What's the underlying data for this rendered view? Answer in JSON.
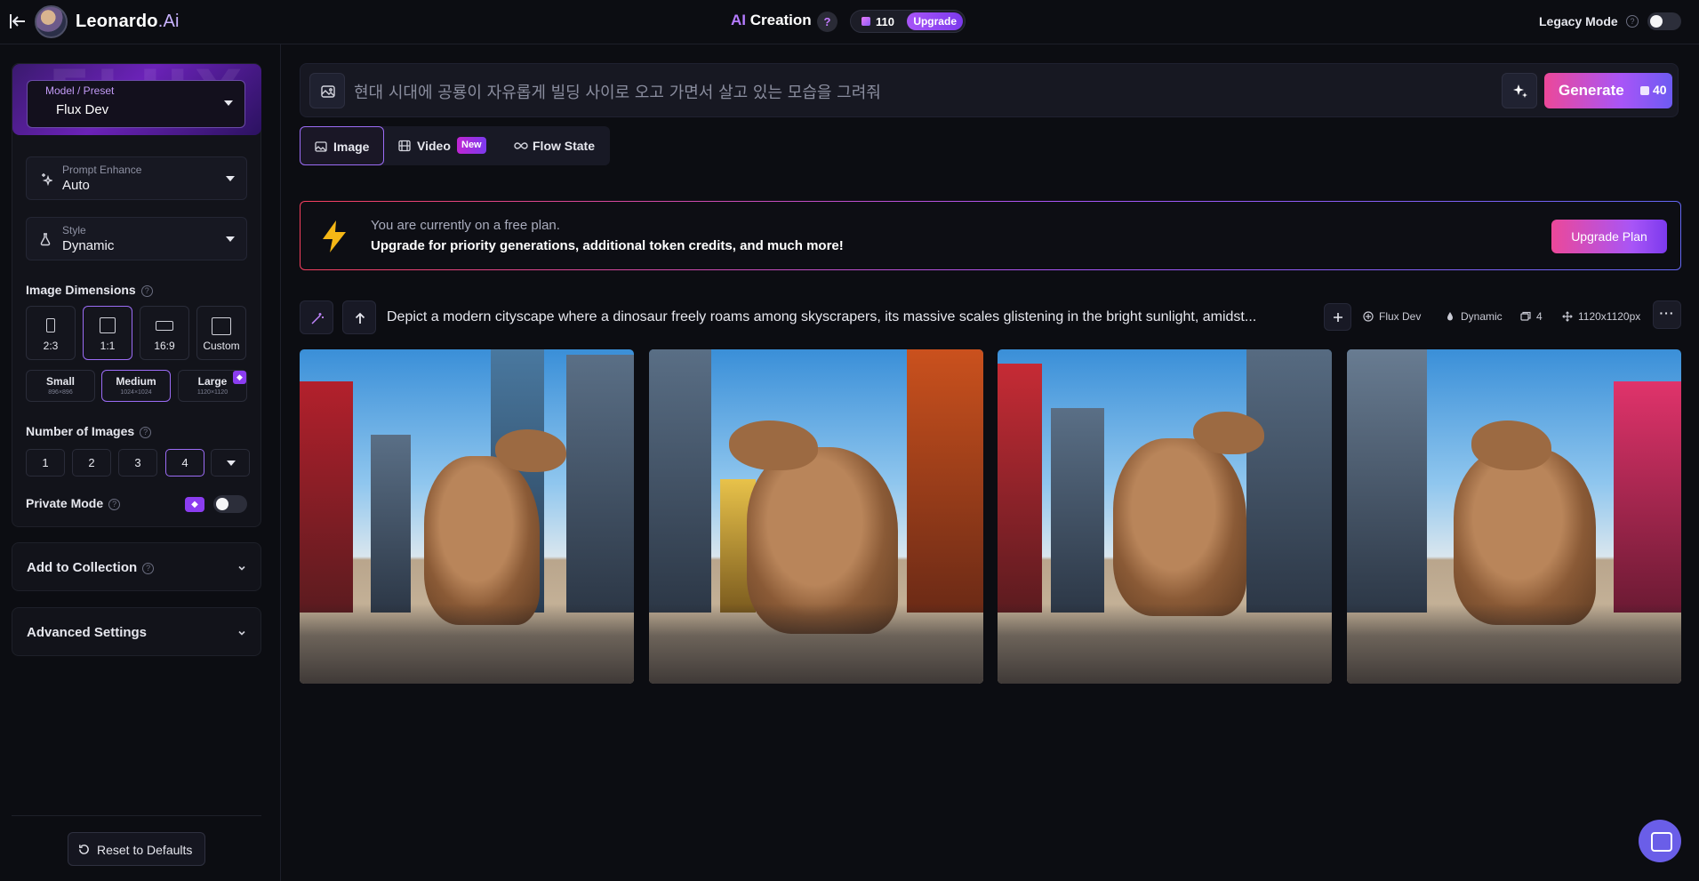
{
  "topbar": {
    "brand_name": "Leonardo",
    "brand_suffix": ".Ai",
    "center_ai": "AI",
    "center_title": " Creation",
    "help": "?",
    "token_count": "110",
    "upgrade_label": "Upgrade",
    "legacy_label": "Legacy Mode",
    "legacy_mode_on": false
  },
  "sidebar": {
    "model": {
      "label": "Model / Preset",
      "value": "Flux Dev",
      "background_text": "FLUX"
    },
    "prompt_enhance": {
      "label": "Prompt Enhance",
      "value": "Auto"
    },
    "style": {
      "label": "Style",
      "value": "Dynamic"
    },
    "image_dimensions_label": "Image Dimensions",
    "aspect_ratios": [
      {
        "label": "2:3",
        "selected": false
      },
      {
        "label": "1:1",
        "selected": true
      },
      {
        "label": "16:9",
        "selected": false
      },
      {
        "label": "Custom",
        "selected": false
      }
    ],
    "sizes": [
      {
        "label": "Small",
        "dims": "896×896",
        "selected": false
      },
      {
        "label": "Medium",
        "dims": "1024×1024",
        "selected": true
      },
      {
        "label": "Large",
        "dims": "1120×1120",
        "selected": false,
        "premium": true
      }
    ],
    "number_of_images_label": "Number of Images",
    "number_options": [
      "1",
      "2",
      "3",
      "4"
    ],
    "number_selected": "4",
    "private_mode_label": "Private Mode",
    "private_mode_on": false,
    "add_to_collection_label": "Add to Collection",
    "advanced_settings_label": "Advanced Settings",
    "reset_label": "Reset to Defaults"
  },
  "prompt": {
    "value": "현대 시대에 공룡이 자유롭게 빌딩 사이로 오고 가면서 살고 있는 모습을 그려줘",
    "generate_label": "Generate",
    "generate_cost": "40"
  },
  "mode_tabs": [
    {
      "label": "Image",
      "selected": true
    },
    {
      "label": "Video",
      "selected": false,
      "badge": "New"
    },
    {
      "label": "Flow State",
      "selected": false
    }
  ],
  "banner": {
    "line1": "You are currently on a free plan.",
    "line2": "Upgrade for priority generations, additional token credits, and much more!",
    "button_label": "Upgrade Plan"
  },
  "generation": {
    "prompt_text": "Depict a modern cityscape where a dinosaur freely roams among skyscrapers, its massive scales glistening in the bright sunlight, amidst...",
    "model": "Flux Dev",
    "style": "Dynamic",
    "count": "4",
    "dimensions": "1120x1120px",
    "more": "···"
  },
  "colors": {
    "accent": "#9b6cf5",
    "generate_gradient_start": "#ec4899",
    "generate_gradient_end": "#6d5bf2",
    "background": "#0c0d12"
  }
}
